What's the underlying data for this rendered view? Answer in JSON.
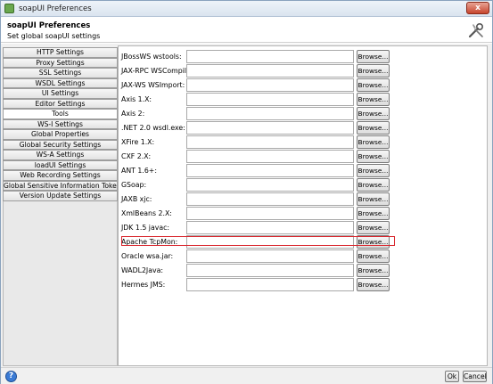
{
  "window": {
    "title": "soapUI Preferences",
    "close_label": "x"
  },
  "header": {
    "title": "soapUI Preferences",
    "subtitle": "Set global soapUI settings"
  },
  "sidebar": {
    "items": [
      {
        "label": "HTTP Settings"
      },
      {
        "label": "Proxy Settings"
      },
      {
        "label": "SSL Settings"
      },
      {
        "label": "WSDL Settings"
      },
      {
        "label": "UI Settings"
      },
      {
        "label": "Editor Settings"
      },
      {
        "label": "Tools"
      },
      {
        "label": "WS-I Settings"
      },
      {
        "label": "Global Properties"
      },
      {
        "label": "Global Security Settings"
      },
      {
        "label": "WS-A Settings"
      },
      {
        "label": "loadUI Settings"
      },
      {
        "label": "Web Recording Settings"
      },
      {
        "label": "Global Sensitive Information Tokens"
      },
      {
        "label": "Version Update Settings"
      }
    ],
    "selected": "Tools"
  },
  "tools": {
    "browse_label": "Browse...",
    "rows": [
      {
        "label": "JBossWS wstools:",
        "value": ""
      },
      {
        "label": "JAX-RPC WSCompile:",
        "value": ""
      },
      {
        "label": "JAX-WS WSImport:",
        "value": ""
      },
      {
        "label": "Axis 1.X:",
        "value": ""
      },
      {
        "label": "Axis 2:",
        "value": ""
      },
      {
        "label": ".NET 2.0 wsdl.exe:",
        "value": ""
      },
      {
        "label": "XFire 1.X:",
        "value": ""
      },
      {
        "label": "CXF 2.X:",
        "value": ""
      },
      {
        "label": "ANT 1.6+:",
        "value": ""
      },
      {
        "label": "GSoap:",
        "value": ""
      },
      {
        "label": "JAXB xjc:",
        "value": ""
      },
      {
        "label": "XmlBeans 2.X:",
        "value": ""
      },
      {
        "label": "JDK 1.5 javac:",
        "value": ""
      },
      {
        "label": "Apache TcpMon:",
        "value": ""
      },
      {
        "label": "Oracle wsa.jar:",
        "value": ""
      },
      {
        "label": "WADL2Java:",
        "value": ""
      },
      {
        "label": "Hermes JMS:",
        "value": ""
      }
    ]
  },
  "footer": {
    "help_label": "?",
    "ok_label": "Ok",
    "cancel_label": "Cancel"
  }
}
